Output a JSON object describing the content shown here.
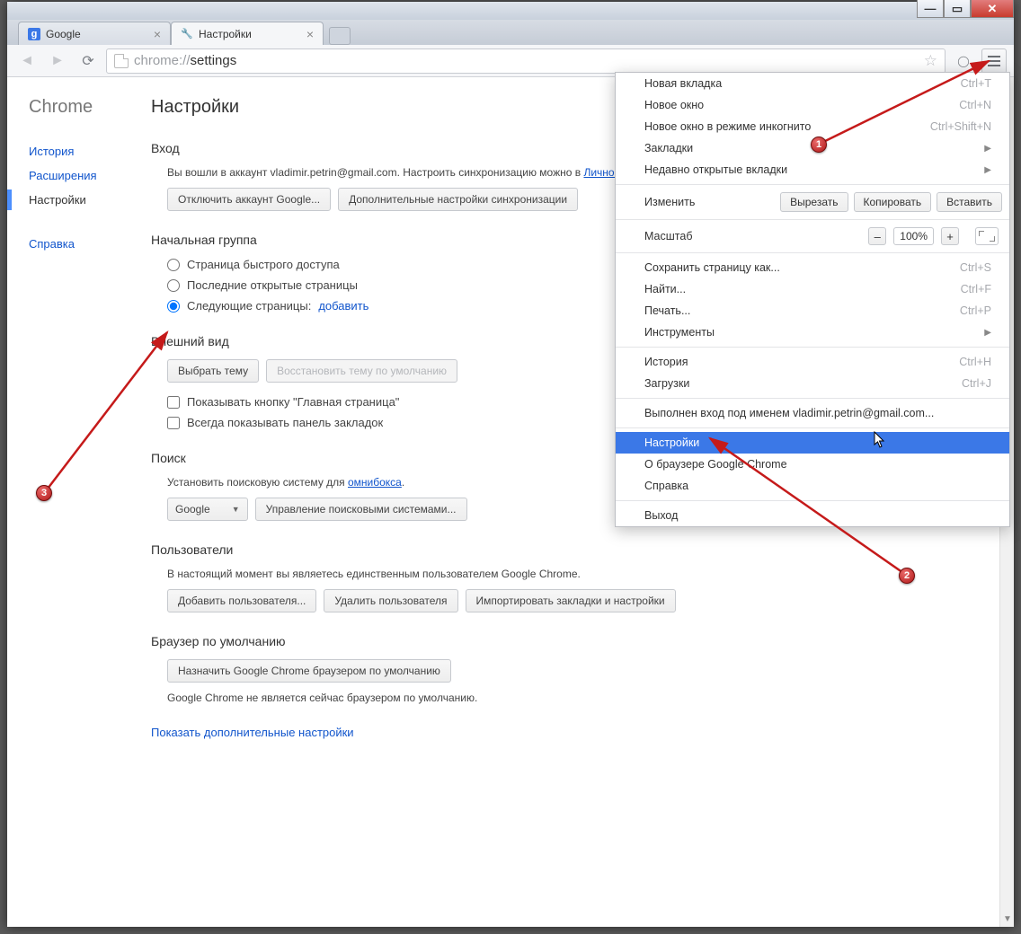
{
  "tabs": [
    {
      "label": "Google"
    },
    {
      "label": "Настройки"
    }
  ],
  "url": {
    "dim": "chrome://",
    "path": "settings"
  },
  "sidebar": {
    "brand": "Chrome",
    "items": [
      "История",
      "Расширения",
      "Настройки"
    ],
    "help": "Справка"
  },
  "page": {
    "title": "Настройки",
    "login": {
      "title": "Вход",
      "text_pre": "Вы вошли в аккаунт vladimir.petrin@gmail.com. Настроить синхронизацию можно в ",
      "link": "Личном Google",
      "btn1": "Отключить аккаунт Google...",
      "btn2": "Дополнительные настройки синхронизации"
    },
    "startup": {
      "title": "Начальная группа",
      "r1": "Страница быстрого доступа",
      "r2": "Последние открытые страницы",
      "r3": "Следующие страницы:",
      "add": "добавить"
    },
    "appearance": {
      "title": "Внешний вид",
      "btn1": "Выбрать тему",
      "btn2": "Восстановить тему по умолчанию",
      "c1": "Показывать кнопку \"Главная страница\"",
      "c2": "Всегда показывать панель закладок"
    },
    "search": {
      "title": "Поиск",
      "text_pre": "Установить поисковую систему для ",
      "link": "омнибокса",
      "engine": "Google",
      "btn": "Управление поисковыми системами..."
    },
    "users": {
      "title": "Пользователи",
      "text": "В настоящий момент вы являетесь единственным пользователем Google Chrome.",
      "b1": "Добавить пользователя...",
      "b2": "Удалить пользователя",
      "b3": "Импортировать закладки и настройки"
    },
    "default": {
      "title": "Браузер по умолчанию",
      "btn": "Назначить Google Chrome браузером по умолчанию",
      "text": "Google Chrome не является сейчас браузером по умолчанию."
    },
    "advanced": "Показать дополнительные настройки"
  },
  "menu": {
    "new_tab": {
      "label": "Новая вкладка",
      "kbd": "Ctrl+T"
    },
    "new_window": {
      "label": "Новое окно",
      "kbd": "Ctrl+N"
    },
    "incognito": {
      "label": "Новое окно в режиме инкогнито",
      "kbd": "Ctrl+Shift+N"
    },
    "bookmarks": "Закладки",
    "recent": "Недавно открытые вкладки",
    "edit_label": "Изменить",
    "cut": "Вырезать",
    "copy": "Копировать",
    "paste": "Вставить",
    "zoom_label": "Масштаб",
    "zoom_value": "100%",
    "save_as": {
      "label": "Сохранить страницу как...",
      "kbd": "Ctrl+S"
    },
    "find": {
      "label": "Найти...",
      "kbd": "Ctrl+F"
    },
    "print": {
      "label": "Печать...",
      "kbd": "Ctrl+P"
    },
    "tools": "Инструменты",
    "history": {
      "label": "История",
      "kbd": "Ctrl+H"
    },
    "downloads": {
      "label": "Загрузки",
      "kbd": "Ctrl+J"
    },
    "signed": "Выполнен вход под именем vladimir.petrin@gmail.com...",
    "settings": "Настройки",
    "about": "О браузере Google Chrome",
    "help": "Справка",
    "exit": "Выход"
  }
}
